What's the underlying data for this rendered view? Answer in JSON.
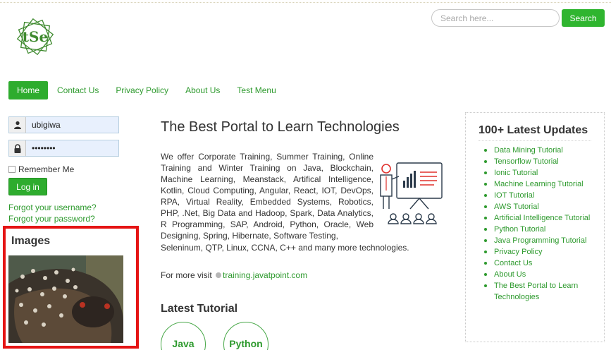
{
  "header": {
    "logo_text": "tSe",
    "search_placeholder": "Search here...",
    "search_button": "Search"
  },
  "nav": {
    "items": [
      {
        "label": "Home",
        "active": true
      },
      {
        "label": "Contact Us"
      },
      {
        "label": "Privacy Policy"
      },
      {
        "label": "About Us"
      },
      {
        "label": "Test Menu"
      }
    ]
  },
  "login": {
    "username_value": "ubigiwa",
    "password_value": "••••••••",
    "remember_label": "Remember Me",
    "login_button": "Log in",
    "forgot_username": "Forgot your username?",
    "forgot_password": "Forgot your password?",
    "user_icon": "user-icon",
    "lock_icon": "lock-icon"
  },
  "images_module": {
    "title": "Images"
  },
  "main": {
    "title": "The Best Portal to Learn Technologies",
    "intro": "We offer Corporate Training, Summer Training, Online Training and Winter Training on Java, Blockchain, Machine Learning, Meanstack, Artifical Intelligence, Kotlin, Cloud Computing, Angular, React, IOT, DevOps, RPA, Virtual Reality, Embedded Systems, Robotics, PHP, .Net, Big Data and Hadoop, Spark, Data Analytics, R Programming, SAP, Android, Python, Oracle, Web Designing, Spring, Hibernate, Software Testing,",
    "intro_last": "Seleninum, QTP, Linux, CCNA, C++ and many more technologies.",
    "more_visit_prefix": "For more visit ",
    "more_visit_link": "training.javatpoint.com",
    "latest_title": "Latest Tutorial",
    "tutorials": [
      "Java",
      "Python"
    ]
  },
  "sidebar": {
    "title": "100+ Latest Updates",
    "items": [
      "Data Mining Tutorial",
      "Tensorflow Tutorial",
      "Ionic Tutorial",
      "Machine Learning Tutorial",
      "IOT Tutorial",
      "AWS Tutorial",
      "Artificial Intelligence Tutorial",
      "Python Tutorial",
      "Java Programming Tutorial",
      "Privacy Policy",
      "Contact Us",
      "About Us",
      "The Best Portal to Learn Technologies"
    ]
  },
  "colors": {
    "accent_green": "#2eac2e",
    "link_green": "#2e9a2e",
    "highlight_red": "#e51414"
  }
}
